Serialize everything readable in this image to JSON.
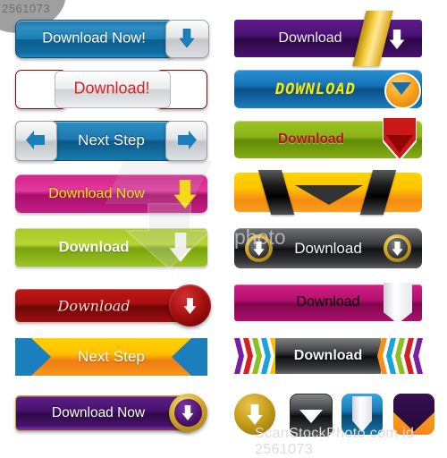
{
  "watermarks": {
    "corner_id": "2561073",
    "middle_text": "photo",
    "bottom_text": "ScanStockPhoto.com id 2561073"
  },
  "left_column": [
    {
      "id": "download-now-blue",
      "label": "Download Now!",
      "style": "blue glossy with silver arrow cap",
      "text_color": "#ffffff",
      "base_color": "#1d7fb3",
      "icon": "arrow-down-icon"
    },
    {
      "id": "download-red-silver",
      "label": "Download!",
      "style": "red end caps with silver center",
      "text_color": "#e02020",
      "base_color": "#b71c1c",
      "icon": "arrow-down-icon"
    },
    {
      "id": "next-step-blue",
      "label": "Next Step",
      "style": "blue center with silver arrow caps",
      "text_color": "#ffffff",
      "base_color": "#1b7ab0",
      "icon": "arrow-left-right-icon"
    },
    {
      "id": "download-now-magenta",
      "label": "Download Now",
      "style": "magenta with yellow arrow",
      "text_color": "#ffe900",
      "base_color": "#d3238d",
      "icon": "arrow-down-icon"
    },
    {
      "id": "download-green",
      "label": "Download",
      "style": "green with white arrow",
      "text_color": "#ffffff",
      "base_color": "#a8c82a",
      "icon": "arrow-down-icon"
    },
    {
      "id": "download-darkred",
      "label": "Download",
      "style": "dark red script with circle badge",
      "text_color": "#f1d5d5",
      "base_color": "#a51010",
      "icon": "arrow-down-circle-icon"
    },
    {
      "id": "next-step-orange",
      "label": "Next Step",
      "style": "orange with blue arrow notches",
      "text_color": "#ffffff",
      "base_color": "#ffc000",
      "icon": "arrow-right-icon"
    },
    {
      "id": "download-now-purple",
      "label": "Download Now",
      "style": "purple with gold ring badge",
      "text_color": "#ffffff",
      "base_color": "#4a1270",
      "icon": "arrow-down-circle-icon"
    }
  ],
  "right_column": [
    {
      "id": "download-purple-ribbon",
      "label": "Download",
      "style": "purple with gold ribbon and white arrow",
      "text_color": "#f0eef5",
      "base_color": "#4b1173",
      "icon": "arrow-down-icon"
    },
    {
      "id": "download-lcd-blue",
      "label": "DOWNLOAD",
      "style": "blue with yellow LCD text and orange circle",
      "text_color": "#ffe800",
      "base_color": "#1574b7",
      "icon": "chevron-down-circle-icon"
    },
    {
      "id": "download-green-shield",
      "label": "Download",
      "style": "green with red shield chevron",
      "text_color": "#b81414",
      "base_color": "#8bb218",
      "icon": "shield-chevron-down-icon"
    },
    {
      "id": "download-yellow-fold",
      "label": "",
      "style": "yellow orange with black ribbon folds and chevron",
      "text_color": "#000000",
      "base_color": "#ffc300",
      "icon": "chevron-down-icon"
    },
    {
      "id": "download-gray-rings",
      "label": "Download",
      "style": "dark gray with two gold ring arrows",
      "text_color": "#f2f2f2",
      "base_color": "#3a3c3f",
      "icon": "arrow-down-circle-icon"
    },
    {
      "id": "download-magenta-banner",
      "label": "Download",
      "style": "magenta with silver banner arrow",
      "text_color": "#ffffff",
      "base_color": "#b81072",
      "icon": "banner-arrow-down-icon"
    },
    {
      "id": "download-chevron-rainbow",
      "label": "Download",
      "style": "dark gray with rainbow chevrons",
      "text_color": "#f5f5f5",
      "base_color": "#3c3e41",
      "icon": "chevrons-icon"
    }
  ],
  "chevron_colors_left": [
    "#7b1fa2",
    "#d32020",
    "#8bc025",
    "#1aa3d6",
    "#f3c300"
  ],
  "chevron_colors_right": [
    "#f3901a",
    "#1aa3d6",
    "#8bc025",
    "#d32020",
    "#7b1fa2"
  ],
  "icon_row": [
    {
      "id": "icon-gold-circle",
      "shape": "circle",
      "icon": "arrow-down-icon",
      "color": "#c79d19"
    },
    {
      "id": "icon-black-square",
      "shape": "rounded-square",
      "icon": "chevron-down-icon",
      "color": "#0d0e10"
    },
    {
      "id": "icon-blue-square",
      "shape": "rounded-square",
      "icon": "banner-arrow-down-icon",
      "color": "#1b7bb4"
    },
    {
      "id": "icon-purple-square",
      "shape": "rounded-square",
      "icon": "chevron-down-icon",
      "color": "#2a0a42"
    }
  ]
}
